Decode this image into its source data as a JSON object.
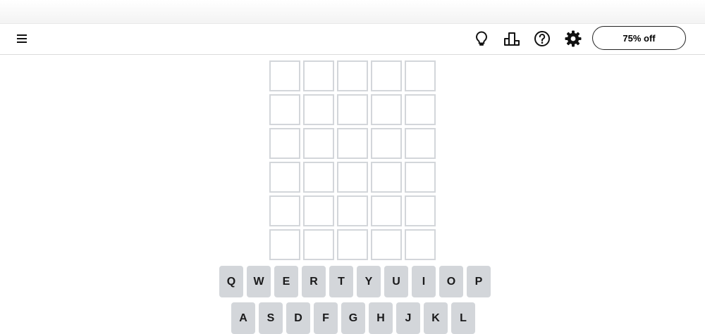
{
  "header": {
    "menu_icon": "hamburger-menu-icon",
    "icons": [
      "lightbulb-icon",
      "leaderboard-icon",
      "help-icon",
      "gear-icon"
    ],
    "promo_label": "75% off"
  },
  "board": {
    "rows": [
      [
        "",
        "",
        "",
        "",
        ""
      ],
      [
        "",
        "",
        "",
        "",
        ""
      ],
      [
        "",
        "",
        "",
        "",
        ""
      ],
      [
        "",
        "",
        "",
        "",
        ""
      ],
      [
        "",
        "",
        "",
        "",
        ""
      ],
      [
        "",
        "",
        "",
        "",
        ""
      ]
    ]
  },
  "keyboard": {
    "row1": [
      "Q",
      "W",
      "E",
      "R",
      "T",
      "Y",
      "U",
      "I",
      "O",
      "P"
    ],
    "row2": [
      "A",
      "S",
      "D",
      "F",
      "G",
      "H",
      "J",
      "K",
      "L"
    ]
  },
  "colors": {
    "tile_border": "#d3d6da",
    "key_background": "#d3d6da",
    "key_text": "#1a1a1b"
  }
}
